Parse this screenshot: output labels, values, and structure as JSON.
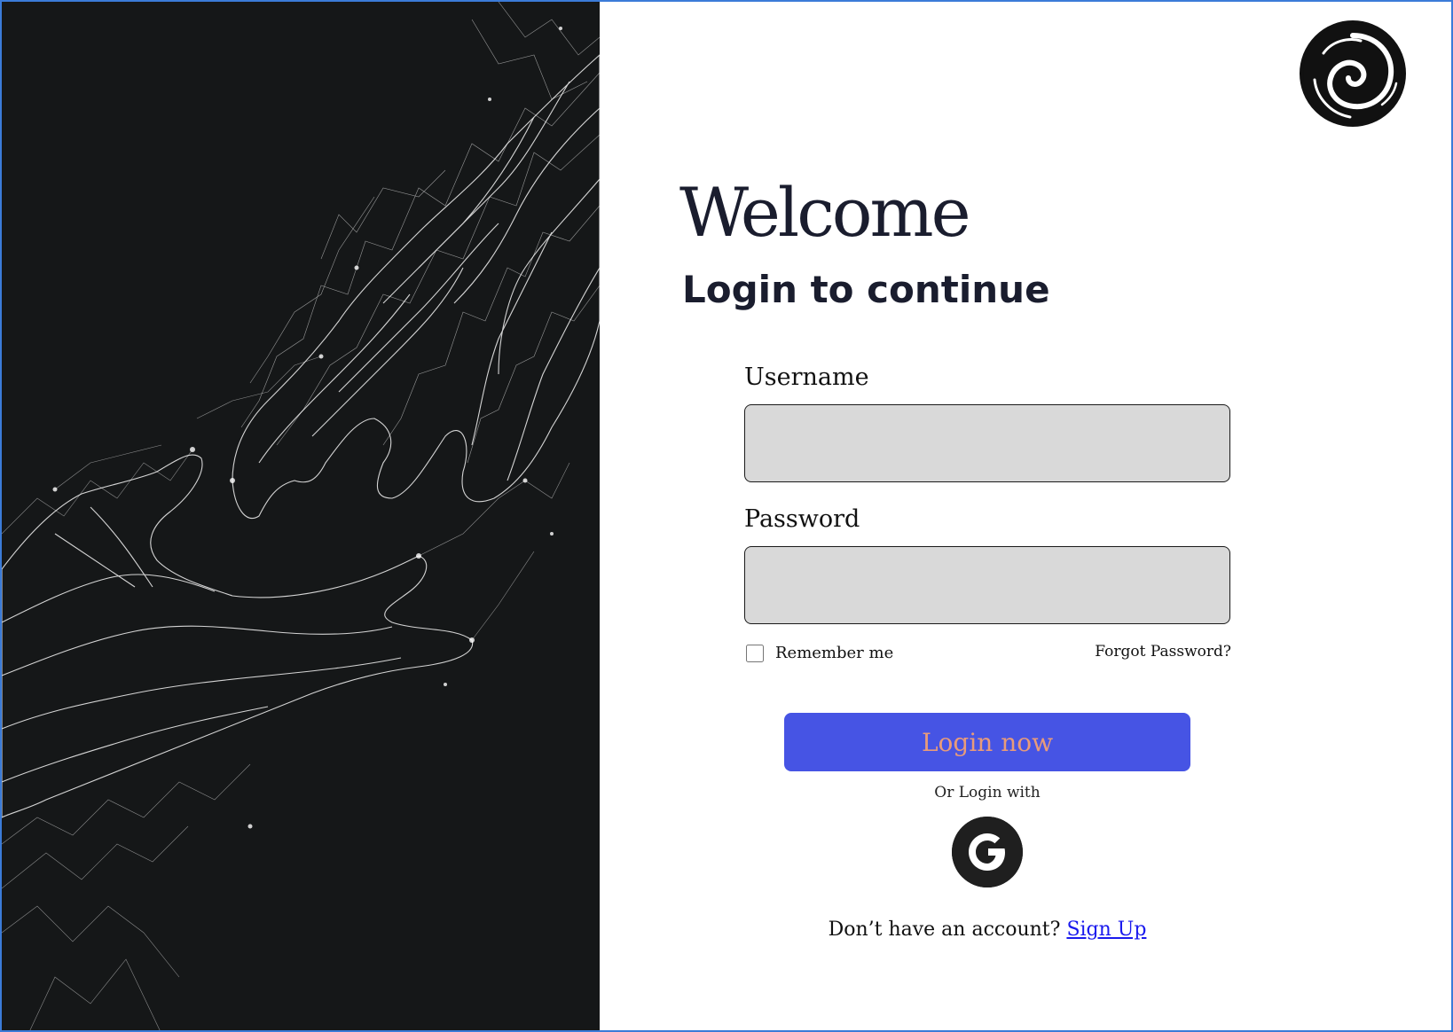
{
  "hero": {
    "image": "wireframe-hands-reaching"
  },
  "brand": {
    "logo_icon": "swirl-logo-icon"
  },
  "header": {
    "welcome": "Welcome",
    "subtitle": "Login to continue"
  },
  "form": {
    "username_label": "Username",
    "username_value": "",
    "password_label": "Password",
    "password_value": "",
    "remember_label": "Remember me",
    "remember_checked": false,
    "forgot_label": "Forgot Password?",
    "login_label": "Login now",
    "or_login_with": "Or Login with",
    "google_icon": "google-icon"
  },
  "footer": {
    "no_account_text": "Don’t have an account?",
    "signup_label": "Sign Up"
  },
  "colors": {
    "login_button": "#4654e4",
    "login_text": "#e89b7a",
    "input_fill": "#d9d9d9",
    "link": "#1a1aee",
    "hero_bg": "#151718"
  }
}
